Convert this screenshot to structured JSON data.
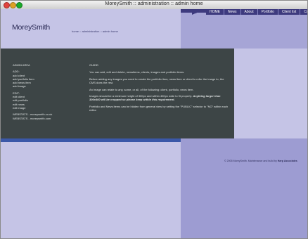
{
  "window": {
    "title": "MoreySmith :: administration :: admin home"
  },
  "nav": {
    "items": [
      "HOME",
      "News",
      "About",
      "Portfolio",
      "Client list",
      "Contact"
    ]
  },
  "site": {
    "logo": "MoreySmith",
    "breadcrumb": "home :: administration :: admin home"
  },
  "sidebar": {
    "heading": "ADMIN AREA",
    "add": {
      "title": "ADD:",
      "items": [
        "add client",
        "add portfolio item",
        "add news item",
        "add image"
      ]
    },
    "edit": {
      "title": "EDIT:",
      "items": [
        "edit client",
        "edit portfolio",
        "edit news",
        "edit image"
      ]
    },
    "webstats": [
      "WEBSTATS - moreysmith.co.uk",
      "WEBSTATS - moreysmith.com"
    ]
  },
  "guide": {
    "title": "GUIDE:",
    "p1": "You can add, edit and delete, newsitems, clients, images and portfolio items.",
    "p2": "Before adding any images you need to create the portfolio item, news item or client to refer the image to, the CMS does the rest.",
    "p3": "An image can relate to any, some, or all, of the following: client, portfolio, news item.",
    "p4a": "Images should be a minimum height of 300px and within 400px wide to fit properly.",
    "p4b": "Anything larger than 300x400 will be cropped so please keep within this requirement.",
    "p5": "Portfolio and News items can be hidden from general view by setting the \"PUBLIC\" selector to \"NO\" within each editor"
  },
  "footer": {
    "text": "© 2005 MoreySmith. Maintenance and build by",
    "link": "Harp Associates"
  }
}
